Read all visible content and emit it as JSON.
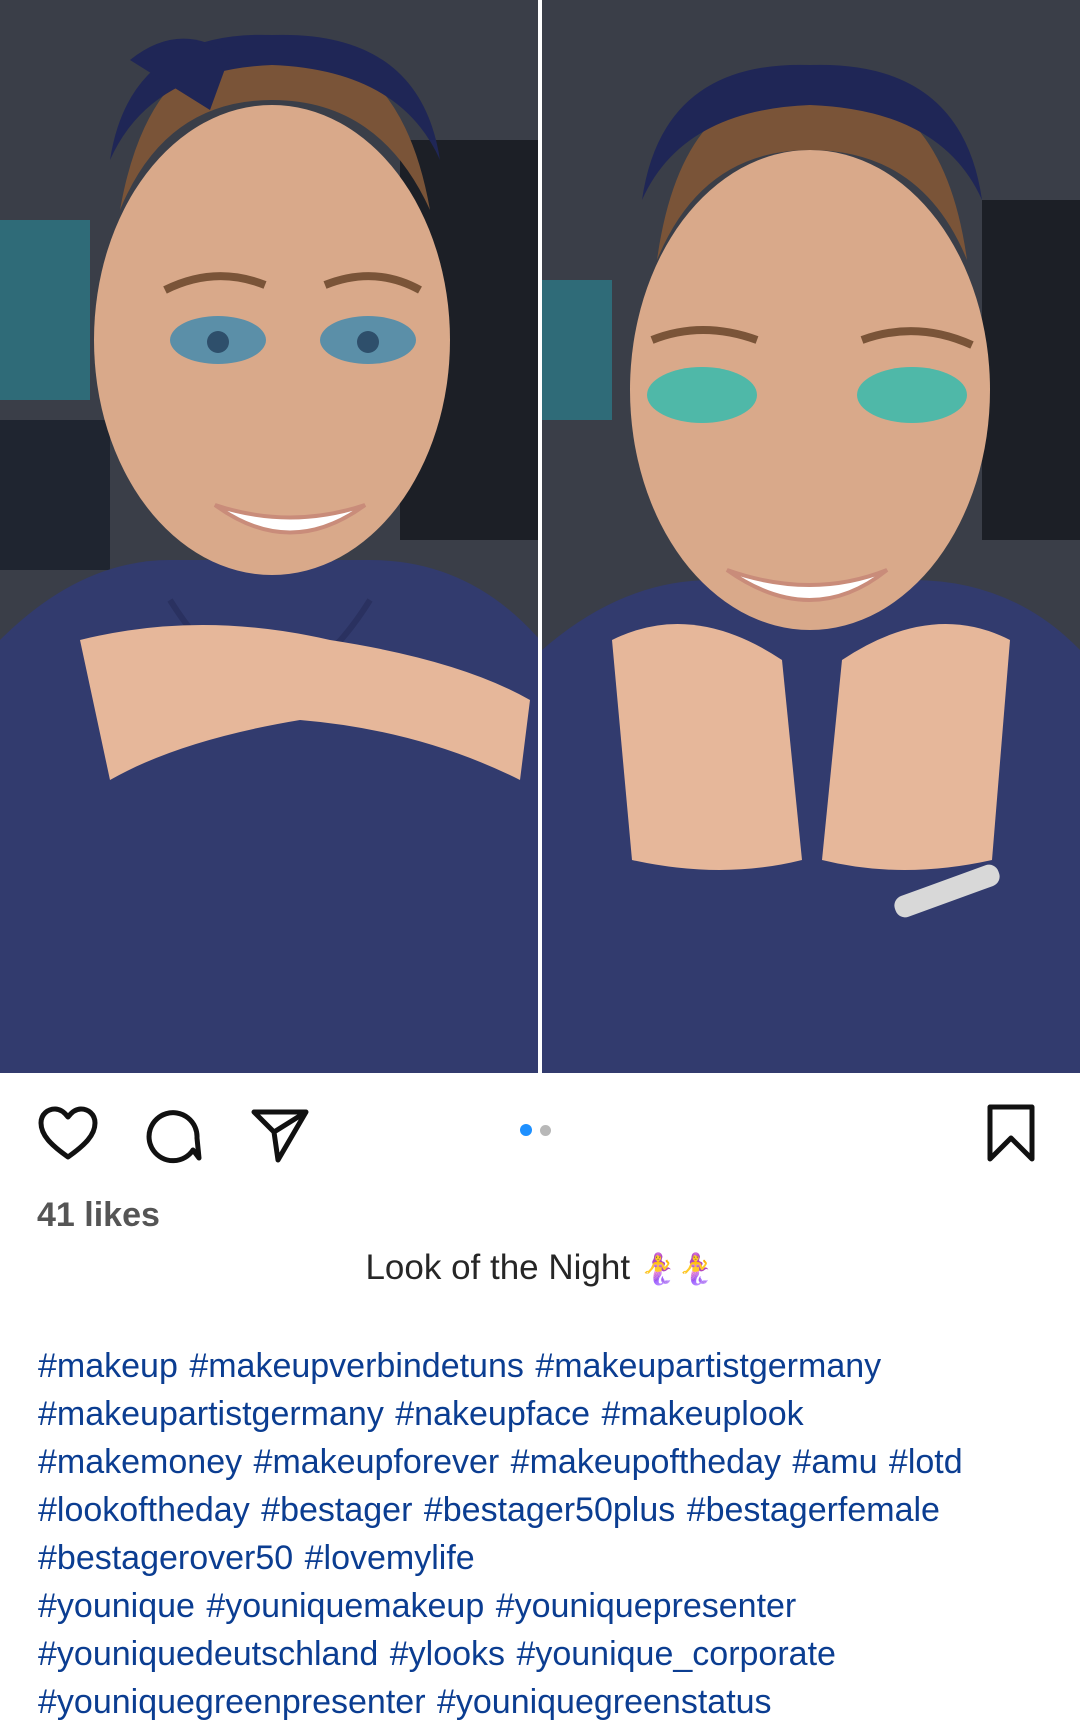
{
  "post": {
    "images": [
      {
        "icon": "selfie-photo-left"
      },
      {
        "icon": "selfie-photo-right"
      }
    ],
    "carousel": {
      "current": 1,
      "total": 2
    },
    "likes_text": "41 likes",
    "caption_title": "Look of the Night",
    "caption_emoji": "🧜‍♀️🧜‍♀️",
    "hashtag_lines": [
      "#makeup #makeupverbindetuns #makeupartistgermany",
      "#makeupartistgermany #nakeupface #makeuplook",
      "#makemoney #makeupforever #makeupoftheday #amu #lotd",
      "#lookoftheday #bestager #bestager50plus #bestagerfemale",
      "#bestagerover50 #lovemylife",
      "#younique #youniquemakeup #youniquepresenter",
      "#youniquedeutschland #ylooks #younique_corporate",
      "#youniquegreenpresenter #youniquegreenstatus"
    ],
    "colors": {
      "accent_dot": "#1e90ff",
      "hashtag": "#0b3d91",
      "text": "#262626"
    }
  }
}
